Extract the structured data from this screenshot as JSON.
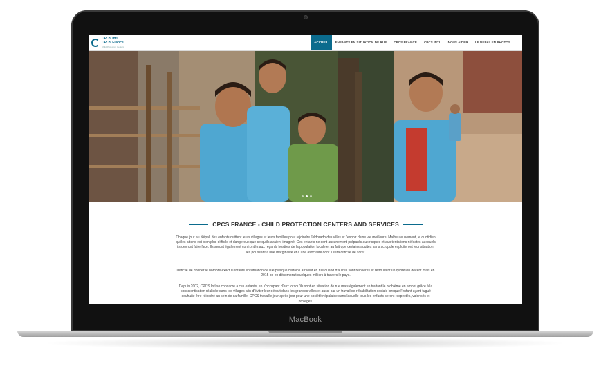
{
  "device": {
    "brand_label": "MacBook"
  },
  "site": {
    "logo": {
      "line1": "CPCS Intl",
      "line2": "CPCS France",
      "tagline": "Child Protection Centers"
    },
    "nav": [
      {
        "label": "ACCUEIL",
        "active": true
      },
      {
        "label": "ENFANTS EN SITUATION DE RUE",
        "active": false
      },
      {
        "label": "CPCS FRANCE",
        "active": false
      },
      {
        "label": "CPCS INTL",
        "active": false
      },
      {
        "label": "NOUS AIDER",
        "active": false
      },
      {
        "label": "LE NÉPAL EN PHOTOS",
        "active": false
      }
    ],
    "carousel": {
      "slide_count": 3,
      "active_index": 1
    },
    "section_title": "CPCS FRANCE - CHILD PROTECTION CENTERS AND SERVICES",
    "paragraphs": [
      "Chaque jour au Népal, des enfants quittent leurs villages et leurs familles pour rejoindre l'eldorado des villes et l'espoir d'une vie meilleure. Malheureusement, le quotidien qui les attend est bien plus difficile et dangereux que ce qu'ils avaient imaginé. Ces enfants ne sont aucunement préparés aux risques et aux tentations néfastes auxquels ils devront faire face. Ils seront également confrontés aux regards hostiles de la population locale et au fait que certains adultes sans scrupule exploiteront leur situation, les poussant à une marginalité et à une asocialité dont il sera difficile de sortir.",
      "Difficile de donner le nombre exact d'enfants en situation de rue puisque certains arrivent en rue quand d'autres sont réinsérés et retrouvent un quotidien décent mais en 2015 on en dénombrait quelques milliers à travers le pays.",
      "Depuis 2002, CPCS Intl se consacre à ces enfants, en s'occupant d'eux lorsqu'ils sont en situation de rue mais également en traitant le problème en amont grâce à la conscientisation réalisée dans les villages afin d'éviter leur départ dans les grandes villes et aussi par un travail de réhabilitation sociale lorsque l'enfant ayant fugué souhaite être réinséré au sein de sa famille. CPCS travaille jour après jour pour une société népalaise dans laquelle tous les enfants seront respectés, valorisés et protégés."
    ]
  },
  "colors": {
    "accent": "#0b6b8d",
    "frame": "#111111"
  },
  "icons": {
    "logo": "cpcs-logo-icon",
    "camera": "camera-icon"
  }
}
